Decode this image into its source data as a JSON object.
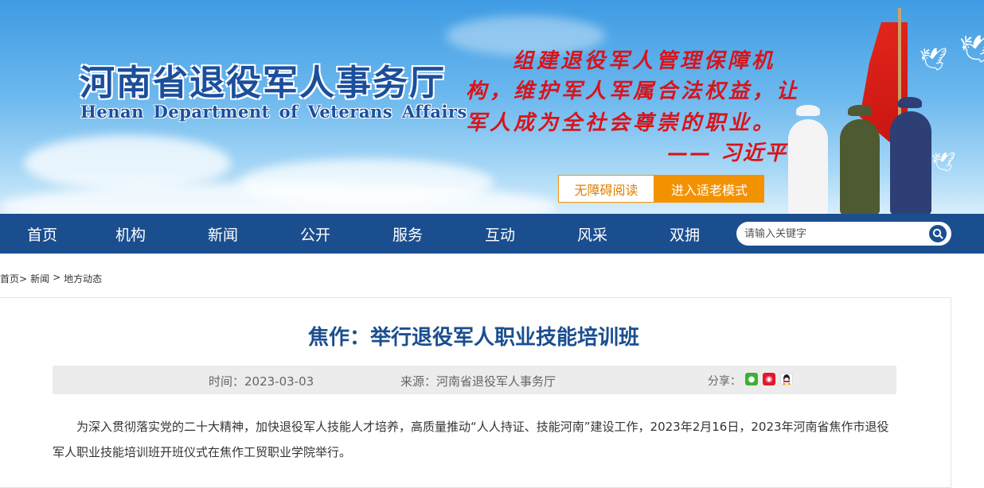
{
  "banner": {
    "title": "河南省退役军人事务厅",
    "subtitle": "Henan Department of Veterans Affairs",
    "quote_lines": [
      "组建退役军人管理保障机",
      "构，维护军人军属合法权益，让",
      "军人成为全社会尊崇的职业。",
      "—— 习近平"
    ],
    "accessibility_label": "无障碍阅读",
    "elder_mode_label": "进入适老模式"
  },
  "nav": {
    "items": [
      "首页",
      "机构",
      "新闻",
      "公开",
      "服务",
      "互动",
      "风采",
      "双拥"
    ],
    "search_placeholder": "请输入关键字"
  },
  "breadcrumb": {
    "items": [
      "首页>",
      "新闻",
      ">",
      "地方动态"
    ]
  },
  "article": {
    "title": "焦作：举行退役军人职业技能培训班",
    "time": "时间：2023-03-03",
    "source": "来源：河南省退役军人事务厅",
    "share_label": "分享：",
    "body": "为深入贯彻落实党的二十大精神，加快退役军人技能人才培养，高质量推动“人人持证、技能河南”建设工作，2023年2月16日，2023年河南省焦作市退役军人职业技能培训班开班仪式在焦作工贸职业学院举行。"
  },
  "colors": {
    "nav_bg": "#1b4e8f",
    "title_color": "#1b4e8f",
    "accent_orange": "#f39200",
    "quote_red": "#d8141b"
  }
}
